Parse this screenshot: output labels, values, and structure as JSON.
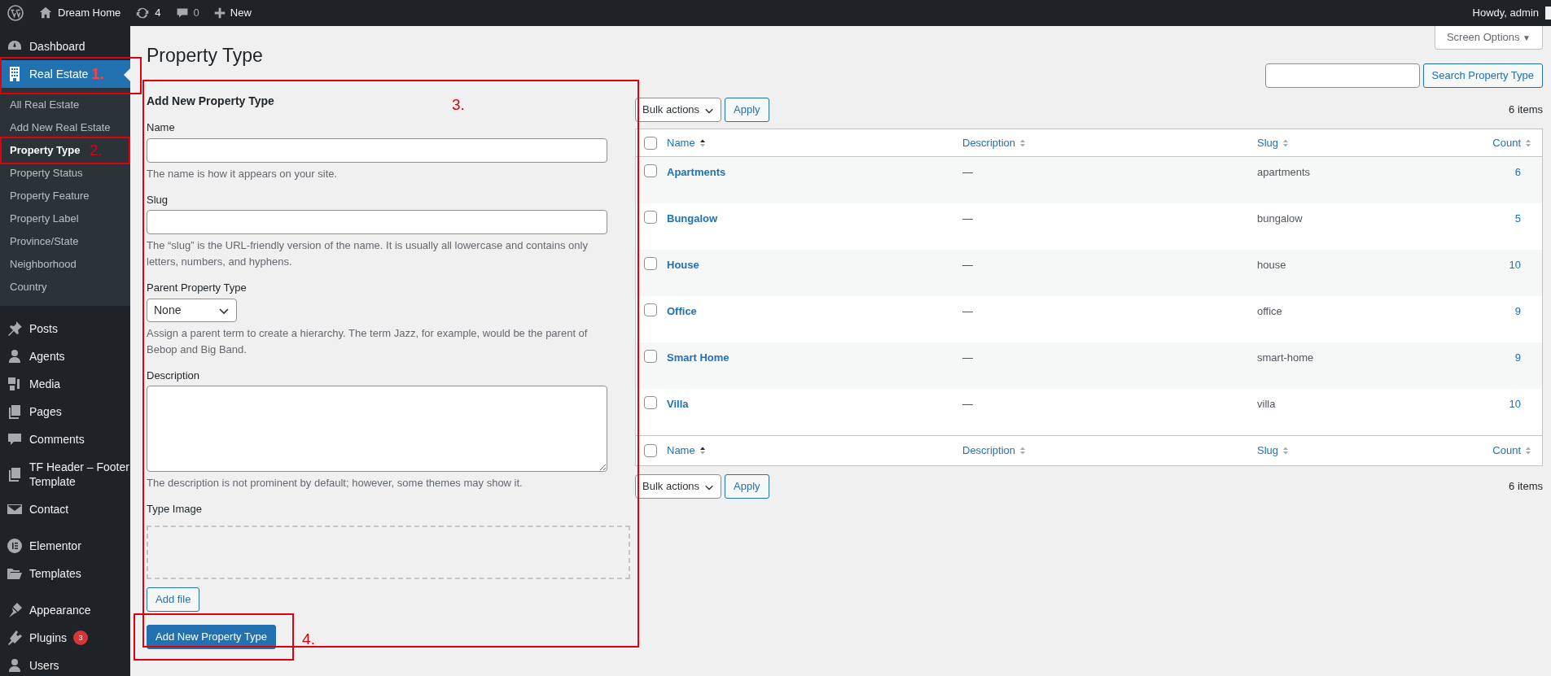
{
  "admin_bar": {
    "site": "Dream Home",
    "updates": "4",
    "comments": "0",
    "new": "New",
    "greeting": "Howdy, admin"
  },
  "sidebar": {
    "groups": [
      [
        {
          "label": "Dashboard",
          "selected": false
        },
        {
          "label": "Real Estate",
          "selected": true,
          "children": [
            {
              "label": "All Real Estate",
              "selected": false
            },
            {
              "label": "Add New Real Estate",
              "selected": false
            },
            {
              "label": "Property Type",
              "selected": true
            },
            {
              "label": "Property Status",
              "selected": false
            },
            {
              "label": "Property Feature",
              "selected": false
            },
            {
              "label": "Property Label",
              "selected": false
            },
            {
              "label": "Province/State",
              "selected": false
            },
            {
              "label": "Neighborhood",
              "selected": false
            },
            {
              "label": "Country",
              "selected": false
            }
          ]
        }
      ],
      [
        {
          "label": "Posts",
          "selected": false
        },
        {
          "label": "Agents",
          "selected": false
        },
        {
          "label": "Media",
          "selected": false
        },
        {
          "label": "Pages",
          "selected": false
        },
        {
          "label": "Comments",
          "selected": false
        },
        {
          "label": "TF Header – Footer Template",
          "selected": false
        },
        {
          "label": "Contact",
          "selected": false
        }
      ],
      [
        {
          "label": "Elementor",
          "selected": false
        },
        {
          "label": "Templates",
          "selected": false
        }
      ],
      [
        {
          "label": "Appearance",
          "selected": false
        },
        {
          "label": "Plugins",
          "badge": "3",
          "selected": false
        },
        {
          "label": "Users",
          "selected": false
        }
      ]
    ]
  },
  "page": {
    "title": "Property Type",
    "screen_options": {
      "label": "Screen Options",
      "caret": "▼"
    }
  },
  "form": {
    "heading": "Add New Property Type",
    "fields": [
      {
        "kind": "text",
        "label": "Name",
        "help": "The name is how it appears on your site."
      },
      {
        "kind": "text",
        "label": "Slug",
        "help": "The “slug” is the URL-friendly version of the name. It is usually all lowercase and contains only letters, numbers, and hyphens."
      },
      {
        "kind": "select",
        "label": "Parent Property Type",
        "value": "None",
        "help": "Assign a parent term to create a hierarchy. The term Jazz, for example, would be the parent of Bebop and Big Band."
      },
      {
        "kind": "textarea",
        "label": "Description",
        "help": "The description is not prominent by default; however, some themes may show it."
      },
      {
        "kind": "image",
        "label": "Type Image",
        "button": "Add file"
      }
    ],
    "submit": "Add New Property Type"
  },
  "search": {
    "button": "Search Property Type"
  },
  "table": {
    "top_actions": {
      "bulk": "Bulk actions",
      "apply": "Apply",
      "count": "6 items"
    },
    "columns": [
      {
        "label": "Name",
        "sorted": true
      },
      {
        "label": "Description",
        "sorted": false
      },
      {
        "label": "Slug",
        "sorted": false
      },
      {
        "label": "Count",
        "sorted": false
      }
    ],
    "footer_columns": [
      {
        "label": "Name",
        "sorted": true
      },
      {
        "label": "Description",
        "sorted": false
      },
      {
        "label": "Slug",
        "sorted": false
      },
      {
        "label": "Count",
        "sorted": false
      }
    ],
    "header_checked": false,
    "footer_checked": false,
    "rows": [
      {
        "name": "Apartments",
        "description": "—",
        "slug": "apartments",
        "count": "6",
        "checked": false
      },
      {
        "name": "Bungalow",
        "description": "—",
        "slug": "bungalow",
        "count": "5",
        "checked": false
      },
      {
        "name": "House",
        "description": "—",
        "slug": "house",
        "count": "10",
        "checked": false
      },
      {
        "name": "Office",
        "description": "—",
        "slug": "office",
        "count": "9",
        "checked": false
      },
      {
        "name": "Smart Home",
        "description": "—",
        "slug": "smart-home",
        "count": "9",
        "checked": false
      },
      {
        "name": "Villa",
        "description": "—",
        "slug": "villa",
        "count": "10",
        "checked": false
      }
    ],
    "bottom_actions": {
      "bulk": "Bulk actions",
      "apply": "Apply",
      "count": "6 items"
    }
  },
  "annotations": [
    {
      "label": "1."
    },
    {
      "label": "2."
    },
    {
      "label": "3."
    },
    {
      "label": "4."
    }
  ]
}
